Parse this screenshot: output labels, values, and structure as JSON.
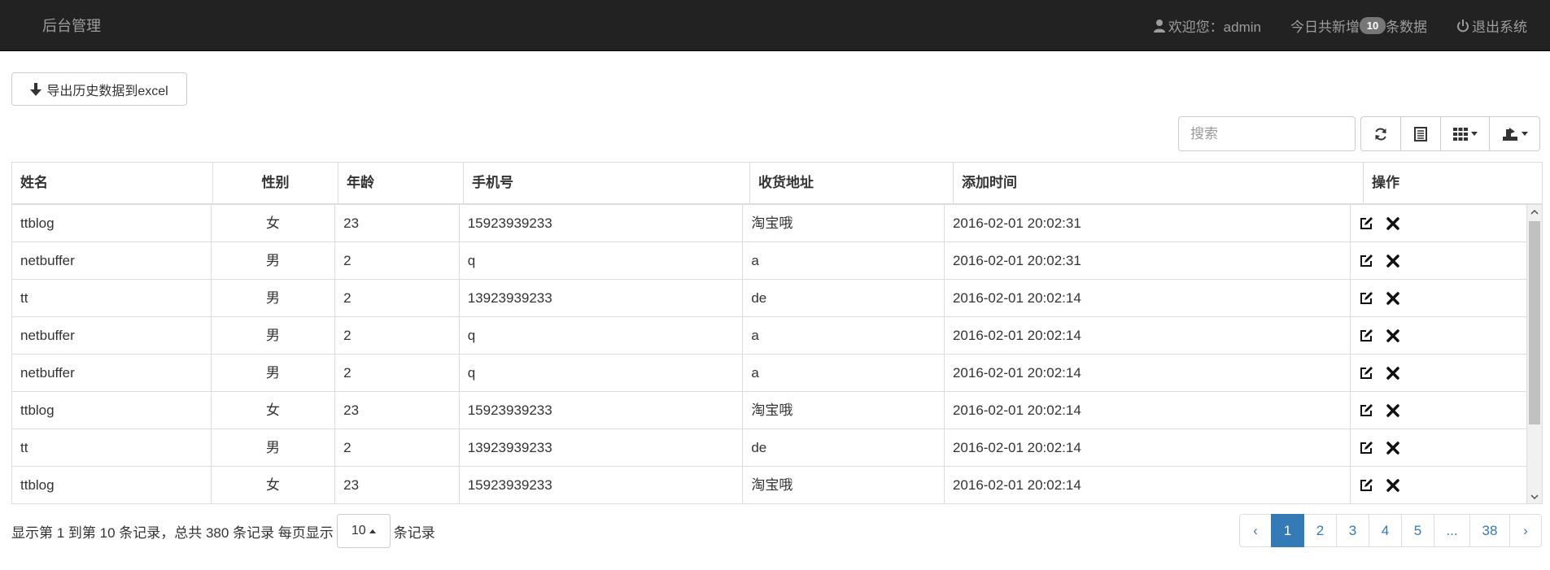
{
  "navbar": {
    "brand": "后台管理",
    "welcome": "欢迎您：admin",
    "today_prefix": "今日共新增",
    "today_count": "10",
    "today_suffix": "条数据",
    "logout": "退出系统"
  },
  "toolbar": {
    "export_label": "导出历史数据到excel",
    "search_placeholder": "搜索",
    "icons": [
      "refresh-icon",
      "list-toggle-icon",
      "columns-icon",
      "export-icon"
    ]
  },
  "table": {
    "headers": [
      "姓名",
      "性别",
      "年龄",
      "手机号",
      "收货地址",
      "添加时间",
      "操作"
    ],
    "rows": [
      [
        "ttblog",
        "女",
        "23",
        "15923939233",
        "淘宝哦",
        "2016-02-01 20:02:31"
      ],
      [
        "netbuffer",
        "男",
        "2",
        "q",
        "a",
        "2016-02-01 20:02:31"
      ],
      [
        "tt",
        "男",
        "2",
        "13923939233",
        "de",
        "2016-02-01 20:02:14"
      ],
      [
        "netbuffer",
        "男",
        "2",
        "q",
        "a",
        "2016-02-01 20:02:14"
      ],
      [
        "netbuffer",
        "男",
        "2",
        "q",
        "a",
        "2016-02-01 20:02:14"
      ],
      [
        "ttblog",
        "女",
        "23",
        "15923939233",
        "淘宝哦",
        "2016-02-01 20:02:14"
      ],
      [
        "tt",
        "男",
        "2",
        "13923939233",
        "de",
        "2016-02-01 20:02:14"
      ],
      [
        "ttblog",
        "女",
        "23",
        "15923939233",
        "淘宝哦",
        "2016-02-01 20:02:14"
      ]
    ]
  },
  "footer": {
    "info_prefix": "显示第 1 到第 10 条记录，总共 380 条记录 每页显示",
    "page_size": "10",
    "info_suffix": "条记录",
    "pages": [
      "‹",
      "1",
      "2",
      "3",
      "4",
      "5",
      "...",
      "38",
      "›"
    ],
    "active_page": "1"
  },
  "colors": {
    "navbar_bg": "#222222",
    "primary": "#337ab7",
    "badge": "#777777"
  }
}
